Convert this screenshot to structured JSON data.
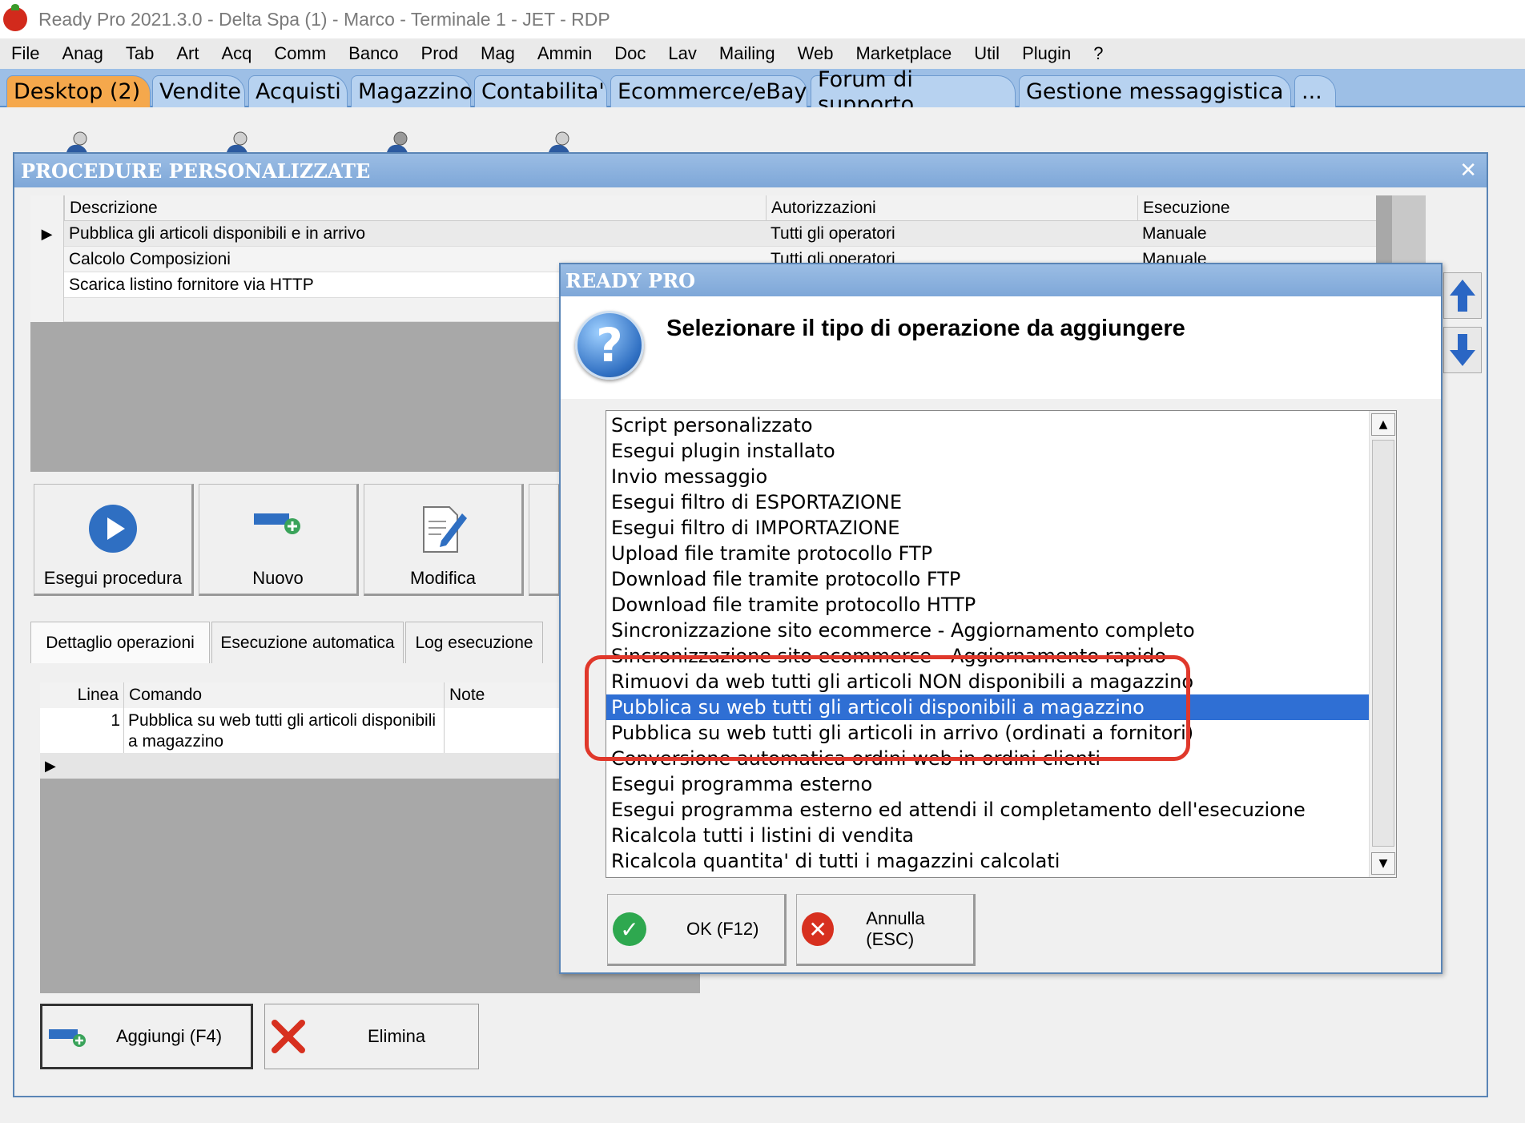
{
  "window": {
    "title": "Ready Pro 2021.3.0 - Delta Spa (1) - Marco - Terminale 1 - JET - RDP"
  },
  "menu": [
    "File",
    "Anag",
    "Tab",
    "Art",
    "Acq",
    "Comm",
    "Banco",
    "Prod",
    "Mag",
    "Ammin",
    "Doc",
    "Lav",
    "Mailing",
    "Web",
    "Marketplace",
    "Util",
    "Plugin",
    "?"
  ],
  "main_tabs": [
    "Desktop (2)",
    "Vendite",
    "Acquisti",
    "Magazzino",
    "Contabilita'",
    "Ecommerce/eBay",
    "Forum di supporto",
    "Gestione messaggistica",
    "..."
  ],
  "procedures": {
    "header": "PROCEDURE PERSONALIZZATE",
    "columns": [
      "Descrizione",
      "Autorizzazioni",
      "Esecuzione"
    ],
    "rows": [
      {
        "desc": "Pubblica gli articoli disponibili e in arrivo",
        "auth": "Tutti gli operatori",
        "exec": "Manuale"
      },
      {
        "desc": "Calcolo Composizioni",
        "auth": "Tutti gli operatori",
        "exec": "Manuale"
      },
      {
        "desc": "Scarica listino fornitore via HTTP",
        "auth": "",
        "exec": ""
      }
    ],
    "buttons": {
      "run": "Esegui procedura",
      "new": "Nuovo",
      "edit": "Modifica"
    },
    "sub_tabs": [
      "Dettaglio operazioni",
      "Esecuzione automatica",
      "Log esecuzione"
    ],
    "ops_columns": [
      "Linea",
      "Comando",
      "Note"
    ],
    "ops_row": {
      "line": "1",
      "command_1": "Pubblica su web tutti gli articoli disponibili",
      "command_2": "a magazzino"
    },
    "footer": {
      "add": "Aggiungi (F4)",
      "delete": "Elimina"
    }
  },
  "dialog": {
    "header": "READY PRO",
    "prompt": "Selezionare il tipo di operazione da aggiungere",
    "items": [
      "Script personalizzato",
      "Esegui plugin installato",
      "Invio messaggio",
      "Esegui filtro di ESPORTAZIONE",
      "Esegui filtro di IMPORTAZIONE",
      "Upload file tramite protocollo FTP",
      "Download file tramite protocollo FTP",
      "Download file tramite protocollo HTTP",
      "Sincronizzazione sito ecommerce - Aggiornamento completo",
      "Sincronizzazione sito ecommerce - Aggiornamento rapido",
      "Rimuovi da web tutti gli articoli NON disponibili a magazzino",
      "Pubblica su web tutti gli articoli disponibili a magazzino",
      "Pubblica su web tutti gli articoli in arrivo (ordinati a fornitori)",
      "Conversione automatica ordini web in ordini clienti",
      "Esegui programma esterno",
      "Esegui programma esterno ed attendi il completamento dell'esecuzione",
      "Ricalcola tutti i listini di vendita",
      "Ricalcola quantita' di tutti i magazzini calcolati"
    ],
    "selected_index": 11,
    "ok": "OK (F12)",
    "cancel": "Annulla (ESC)"
  },
  "colors": {
    "accent": "#2f6fd4",
    "tab_active": "#f5a84c",
    "highlight": "#e0382b"
  }
}
